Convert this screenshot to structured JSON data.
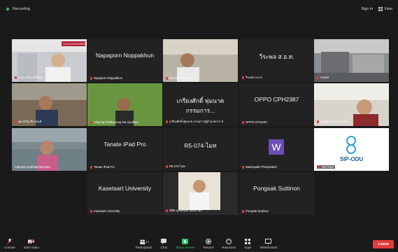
{
  "topbar": {
    "recording": "Recording",
    "sign_in": "Sign in",
    "view": "View"
  },
  "tiles": [
    {
      "name": "อ.ดร.ภวิตร ทีรพิมุข",
      "big": "",
      "type": "video"
    },
    {
      "name": "Napaporn Noppakhun",
      "big": "Napaporn Noppakhun",
      "type": "name"
    },
    {
      "name": "Rancha Reanyuan",
      "big": "",
      "type": "video"
    },
    {
      "name": "วีระพล ส.อ.ท.",
      "big": "วีระพล ส.อ.ท.",
      "type": "name"
    },
    {
      "name": "กรบพร",
      "big": "",
      "type": "video"
    },
    {
      "name": "ผศ.ชเริญ ปิยาทนต์",
      "big": "",
      "type": "video"
    },
    {
      "name": "Siripong Palakawong-Na-Ayudhya",
      "big": "",
      "type": "video"
    },
    {
      "name": "เกรียงศักดิ์ พุ่มนาค กรรมการผู้อำนวยการ ธ์",
      "big": "เกรียงศักดิ์ พุ่มนาค กรรมการ...",
      "type": "name"
    },
    {
      "name": "OPPO CPH2387",
      "big": "OPPO CPH2387",
      "type": "name"
    },
    {
      "name": "บุญยืน เยาวภังกลมทิ์บ",
      "big": "",
      "type": "video"
    },
    {
      "name": "Sabunee Budhakoonchana",
      "big": "",
      "type": "video"
    },
    {
      "name": "Tanate iPad Pro",
      "big": "Tanate iPad Pro",
      "type": "name"
    },
    {
      "name": "R5-074-ไมท",
      "big": "R5-074-ไมท",
      "type": "name"
    },
    {
      "name": "Wasinpailin Phanphakdi",
      "big": "W",
      "type": "avatar"
    },
    {
      "name": "SIP-ODU",
      "big": "SIP-ODU",
      "type": "logo"
    },
    {
      "name": "Kasetsart University",
      "big": "Kasetsart University",
      "type": "name"
    },
    {
      "name": "นิติศ บุณฑฤทธิ์ แดดสำนัก",
      "big": "",
      "type": "video"
    },
    {
      "name": "Pongsak Suttinon",
      "big": "Pongsak Suttinon",
      "type": "name"
    }
  ],
  "controls": {
    "unmute": "Unmute",
    "start_video": "Start Video",
    "participants": "Participants",
    "participants_count": "19",
    "chat": "Chat",
    "share": "Share Screen",
    "record": "Record",
    "reactions": "Reactions",
    "apps": "Apps",
    "whiteboards": "Whiteboards",
    "leave": "Leave"
  },
  "logo_text": "CHULA ENGINEERING"
}
